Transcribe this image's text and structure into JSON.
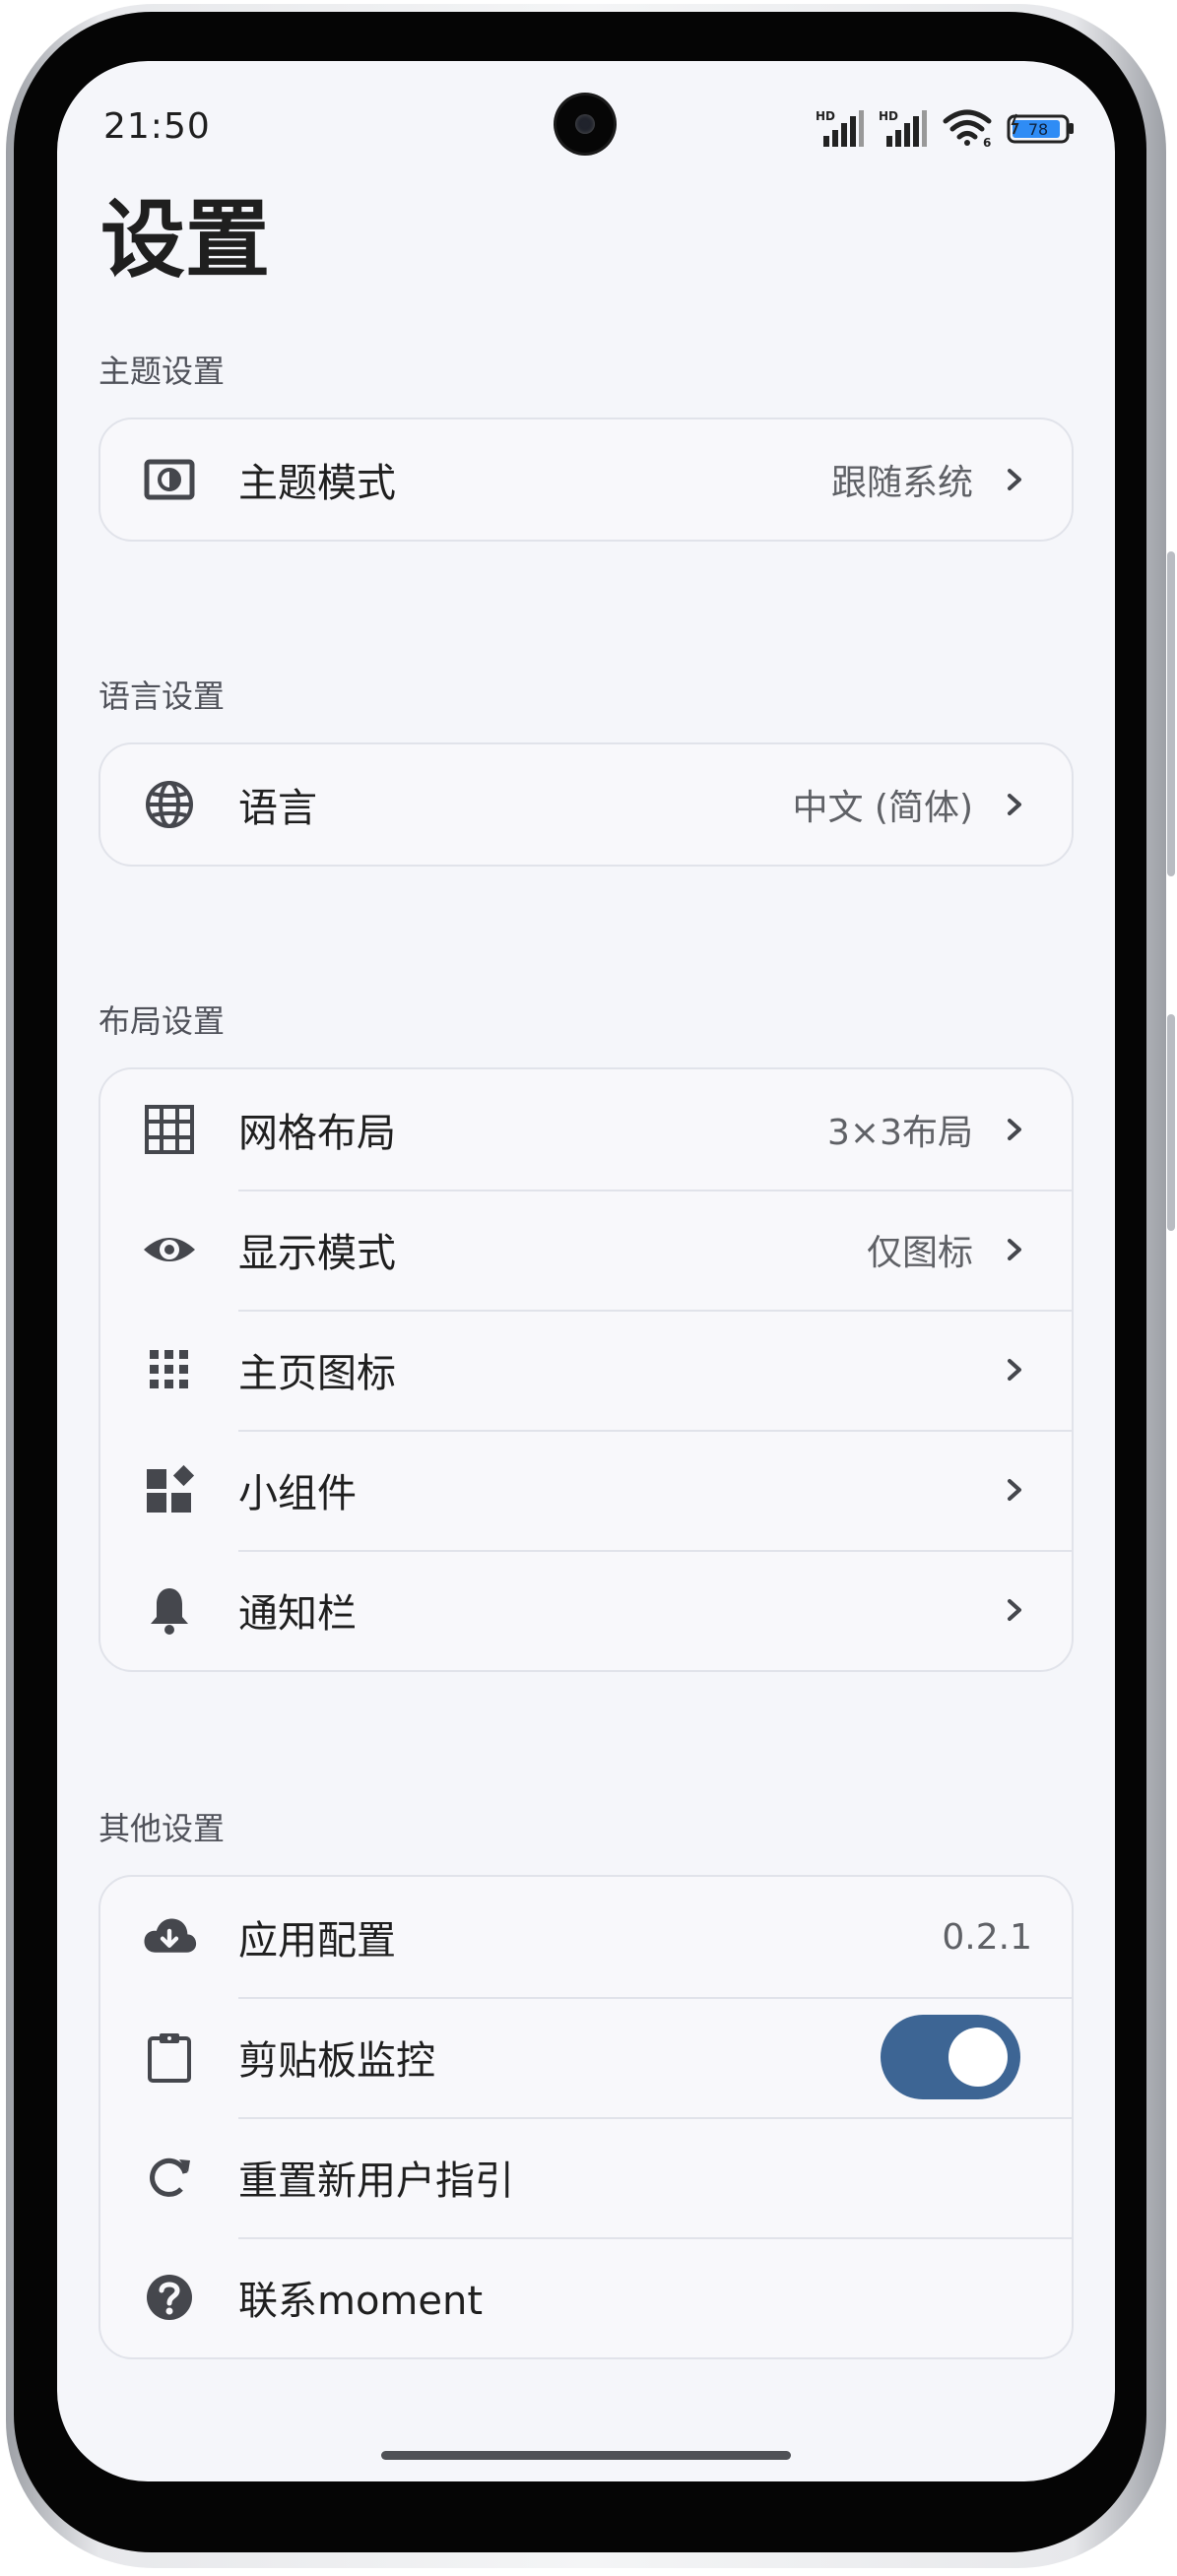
{
  "status_bar": {
    "time": "21:50",
    "signal1_label": "HD",
    "signal2_label": "HD",
    "wifi_sub": "6",
    "battery": "78"
  },
  "page": {
    "title": "设置"
  },
  "sections": {
    "theme": {
      "label": "主题设置",
      "items": [
        {
          "label": "主题模式",
          "value": "跟随系统",
          "icon": "theme-mode-icon"
        }
      ]
    },
    "language": {
      "label": "语言设置",
      "items": [
        {
          "label": "语言",
          "value": "中文 (简体)",
          "icon": "globe-icon"
        }
      ]
    },
    "layout": {
      "label": "布局设置",
      "items": [
        {
          "label": "网格布局",
          "value": "3×3布局",
          "icon": "grid-icon"
        },
        {
          "label": "显示模式",
          "value": "仅图标",
          "icon": "eye-icon"
        },
        {
          "label": "主页图标",
          "value": "",
          "icon": "apps-icon"
        },
        {
          "label": "小组件",
          "value": "",
          "icon": "widgets-icon"
        },
        {
          "label": "通知栏",
          "value": "",
          "icon": "bell-icon"
        }
      ]
    },
    "other": {
      "label": "其他设置",
      "items": [
        {
          "label": "应用配置",
          "value": "0.2.1",
          "icon": "cloud-download-icon"
        },
        {
          "label": "剪贴板监控",
          "toggle_on": true,
          "icon": "clipboard-icon"
        },
        {
          "label": "重置新用户指引",
          "icon": "refresh-icon"
        },
        {
          "label": "联系moment",
          "icon": "help-icon"
        }
      ]
    }
  },
  "colors": {
    "background": "#f5f6fa",
    "card": "#f8f8fb",
    "text_primary": "#1f1f1f",
    "text_secondary": "#5f6166",
    "toggle_on": "#3d6594",
    "icon": "#45474d",
    "battery_fill": "#2f8cf5"
  }
}
